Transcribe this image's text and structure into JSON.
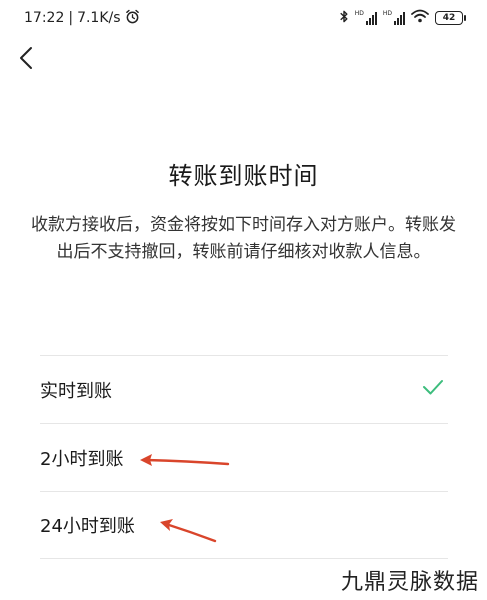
{
  "status_bar": {
    "time": "17:22",
    "network_speed": "7.1K/s",
    "battery": "42",
    "hd_label": "HD",
    "icons": [
      "alarm-icon",
      "bluetooth-icon",
      "signal-icon",
      "wifi-icon",
      "battery-icon"
    ]
  },
  "header": {
    "back_icon": "chevron-left-icon"
  },
  "main": {
    "title": "转账到账时间",
    "description": "收款方接收后，资金将按如下时间存入对方账户。转账发出后不支持撤回，转账前请仔细核对收款人信息。",
    "options": [
      {
        "label": "实时到账",
        "selected": true
      },
      {
        "label": "2小时到账",
        "selected": false
      },
      {
        "label": "24小时到账",
        "selected": false
      }
    ]
  },
  "colors": {
    "check": "#3dbd7d",
    "arrow": "#d9452b"
  },
  "watermark": "九鼎灵脉数据"
}
